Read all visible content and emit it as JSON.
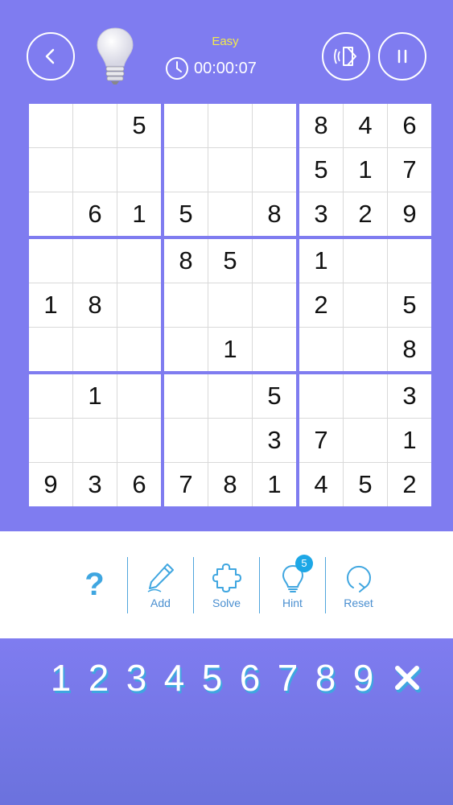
{
  "header": {
    "difficulty": "Easy",
    "timer": "00:00:07"
  },
  "board": [
    [
      "",
      "",
      "5",
      "",
      "",
      "",
      "8",
      "4",
      "6"
    ],
    [
      "",
      "",
      "",
      "",
      "",
      "",
      "5",
      "1",
      "7"
    ],
    [
      "",
      "6",
      "1",
      "5",
      "",
      "8",
      "3",
      "2",
      "9"
    ],
    [
      "",
      "",
      "",
      "8",
      "5",
      "",
      "1",
      "",
      ""
    ],
    [
      "1",
      "8",
      "",
      "",
      "",
      "",
      "2",
      "",
      "5"
    ],
    [
      "",
      "",
      "",
      "",
      "1",
      "",
      "",
      "",
      "8"
    ],
    [
      "",
      "1",
      "",
      "",
      "",
      "5",
      "",
      "",
      "3"
    ],
    [
      "",
      "",
      "",
      "",
      "",
      "3",
      "7",
      "",
      "1"
    ],
    [
      "9",
      "3",
      "6",
      "7",
      "8",
      "1",
      "4",
      "5",
      "2"
    ]
  ],
  "toolbar": {
    "help_label": "?",
    "add_label": "Add",
    "solve_label": "Solve",
    "hint_label": "Hint",
    "hint_count": "5",
    "reset_label": "Reset"
  },
  "numpad": [
    "1",
    "2",
    "3",
    "4",
    "5",
    "6",
    "7",
    "8",
    "9"
  ],
  "colors": {
    "background": "#7f7cf0",
    "accent": "#3fa6e0",
    "difficulty": "#f2ea4b"
  }
}
